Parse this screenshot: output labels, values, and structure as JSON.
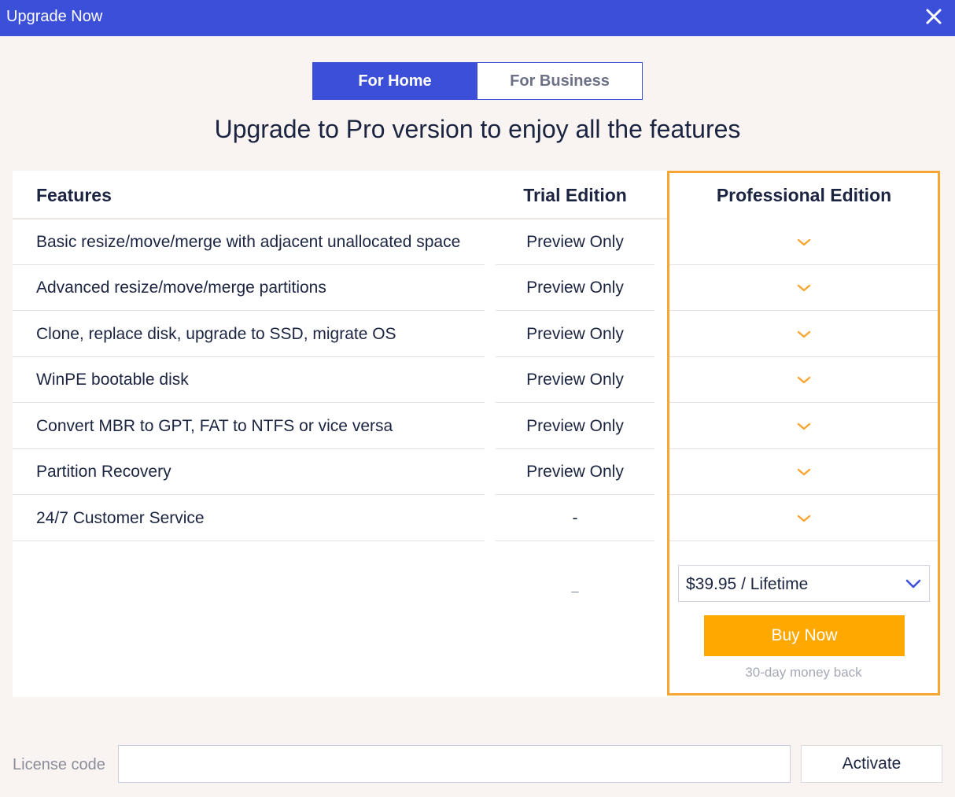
{
  "window": {
    "title": "Upgrade Now",
    "close_icon": "close-icon"
  },
  "tabs": [
    {
      "label": "For Home",
      "active": true
    },
    {
      "label": "For Business",
      "active": false
    }
  ],
  "headline": "Upgrade to Pro version to enjoy all the features",
  "table": {
    "headers": {
      "features": "Features",
      "trial": "Trial Edition",
      "pro": "Professional Edition"
    },
    "rows": [
      {
        "feature": "Basic resize/move/merge with adjacent unallocated space",
        "trial": "Preview Only",
        "pro": "check-icon"
      },
      {
        "feature": "Advanced resize/move/merge partitions",
        "trial": "Preview Only",
        "pro": "check-icon"
      },
      {
        "feature": "Clone, replace disk, upgrade to SSD, migrate OS",
        "trial": "Preview Only",
        "pro": "check-icon"
      },
      {
        "feature": "WinPE bootable disk",
        "trial": "Preview Only",
        "pro": "check-icon"
      },
      {
        "feature": "Convert MBR to GPT, FAT to NTFS or vice versa",
        "trial": "Preview Only",
        "pro": "check-icon"
      },
      {
        "feature": "Partition Recovery",
        "trial": "Preview Only",
        "pro": "check-icon"
      },
      {
        "feature": "24/7 Customer Service",
        "trial": "-",
        "pro": "check-icon"
      }
    ],
    "trial_price_placeholder": "_"
  },
  "pricing": {
    "selected": "$39.95 / Lifetime",
    "buy_label": "Buy Now",
    "money_back": "30-day money back"
  },
  "license": {
    "label": "License code",
    "value": "",
    "activate_label": "Activate"
  },
  "colors": {
    "brand_blue": "#3b4fd8",
    "pro_border": "#f7a632",
    "check": "#f7a632",
    "buy_button": "#fea800"
  }
}
